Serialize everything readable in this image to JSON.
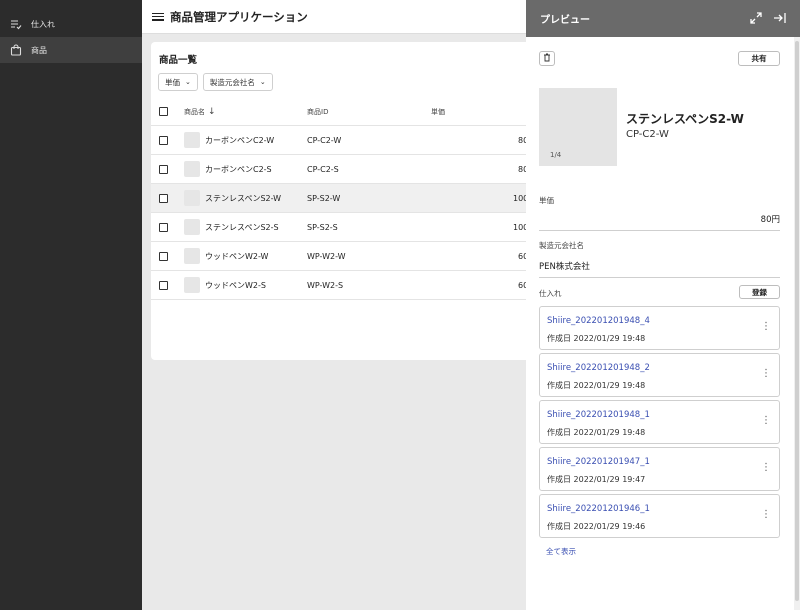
{
  "sidebar": {
    "items": [
      {
        "label": "仕入れ",
        "icon": "list-check-icon"
      },
      {
        "label": "商品",
        "icon": "shopping-bag-icon"
      }
    ]
  },
  "header": {
    "title": "商品管理アプリケーション"
  },
  "main": {
    "card_title": "商品一覧",
    "filters": [
      {
        "label": "単価"
      },
      {
        "label": "製造元会社名"
      }
    ],
    "columns": {
      "name": "商品名",
      "id": "商品ID",
      "price": "単価"
    },
    "rows": [
      {
        "name": "カーボンペンC2-W",
        "id": "CP-C2-W",
        "price": "80"
      },
      {
        "name": "カーボンペンC2-S",
        "id": "CP-C2-S",
        "price": "80"
      },
      {
        "name": "ステンレスペンS2-W",
        "id": "SP-S2-W",
        "price": "100"
      },
      {
        "name": "ステンレスペンS2-S",
        "id": "SP-S2-S",
        "price": "100"
      },
      {
        "name": "ウッドペンW2-W",
        "id": "WP-W2-W",
        "price": "60"
      },
      {
        "name": "ウッドペンW2-S",
        "id": "WP-W2-S",
        "price": "60"
      }
    ]
  },
  "preview": {
    "title": "プレビュー",
    "share_label": "共有",
    "image_count": "1/4",
    "product_name": "ステンレスペンS2-W",
    "product_code": "CP-C2-W",
    "price_label": "単価",
    "price_value": "80円",
    "maker_label": "製造元会社名",
    "maker_value": "PEN株式会社",
    "shiire_label": "仕入れ",
    "register_label": "登録",
    "shiire_items": [
      {
        "id": "Shiire_202201201948_4",
        "date": "作成日 2022/01/29 19:48"
      },
      {
        "id": "Shiire_202201201948_2",
        "date": "作成日 2022/01/29 19:48"
      },
      {
        "id": "Shiire_202201201948_1",
        "date": "作成日 2022/01/29 19:48"
      },
      {
        "id": "Shiire_202201201947_1",
        "date": "作成日 2022/01/29 19:47"
      },
      {
        "id": "Shiire_202201201946_1",
        "date": "作成日 2022/01/29 19:46"
      }
    ],
    "show_all_label": "全て表示"
  }
}
